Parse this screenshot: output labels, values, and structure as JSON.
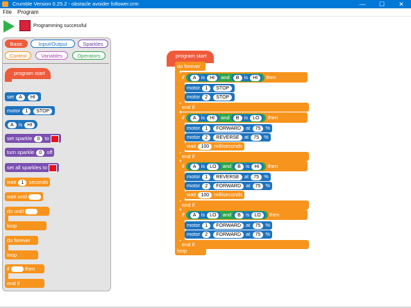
{
  "window": {
    "title": "Crumble Version 0.25.2 - obstacle avoider follower.crm",
    "controls": {
      "minimize": "—",
      "maximize": "☐",
      "close": "✕"
    }
  },
  "menu": [
    "File",
    "Program"
  ],
  "toolbar": {
    "status": "Programming successful"
  },
  "palette": {
    "categories": [
      "Basic",
      "Input/Output",
      "Sparkles",
      "Control",
      "Variables",
      "Operators"
    ],
    "blocks": {
      "program_start": "program start",
      "set": "set",
      "A": "A",
      "HI": "HI",
      "motor": "motor",
      "one": "1",
      "stop": "STOP",
      "is": "is",
      "set_sparkle": "set sparkle",
      "zero": "0",
      "to": "to",
      "turn_sparkle": "turn sparkle",
      "off": "off",
      "set_all_sparkles": "set all sparkles to",
      "wait": "wait",
      "seconds": "seconds",
      "wait_until": "wait until",
      "do_until": "do until",
      "loop": "loop",
      "do_forever": "do forever",
      "if": "if",
      "then": "then",
      "end_if": "end if"
    }
  },
  "script": {
    "program_start": "program start",
    "do_forever": "do forever",
    "loop": "loop",
    "kw": {
      "if": "if",
      "then": "then",
      "and": "and",
      "is": "is",
      "end_if": "end if",
      "motor": "motor",
      "at": "at",
      "pct": "%",
      "wait": "wait",
      "ms": "milliseconds"
    },
    "if_blocks": [
      {
        "a": "A",
        "a_val": "HI",
        "b": "B",
        "b_val": "HI",
        "motors": [
          {
            "num": "1",
            "action": "STOP"
          },
          {
            "num": "2",
            "action": "STOP"
          }
        ],
        "wait": ""
      },
      {
        "a": "A",
        "a_val": "HI",
        "b": "B",
        "b_val": "LO",
        "motors": [
          {
            "num": "1",
            "action": "FORWARD",
            "speed": "75"
          },
          {
            "num": "2",
            "action": "REVERSE",
            "speed": "75"
          }
        ],
        "wait": "100"
      },
      {
        "a": "A",
        "a_val": "LO",
        "b": "B",
        "b_val": "HI",
        "motors": [
          {
            "num": "1",
            "action": "REVERSE",
            "speed": "75"
          },
          {
            "num": "2",
            "action": "FORWARD",
            "speed": "75"
          }
        ],
        "wait": "100"
      },
      {
        "a": "A",
        "a_val": "LO",
        "b": "B",
        "b_val": "LO",
        "motors": [
          {
            "num": "1",
            "action": "FORWARD",
            "speed": "75"
          },
          {
            "num": "2",
            "action": "FORWARD",
            "speed": "75"
          }
        ],
        "wait": ""
      }
    ]
  },
  "colors": {
    "control": "#f7941d",
    "motor": "#1e73be",
    "condition": "#2ea64a",
    "start": "#ef5a3a",
    "titlebar": "#0078d7"
  }
}
